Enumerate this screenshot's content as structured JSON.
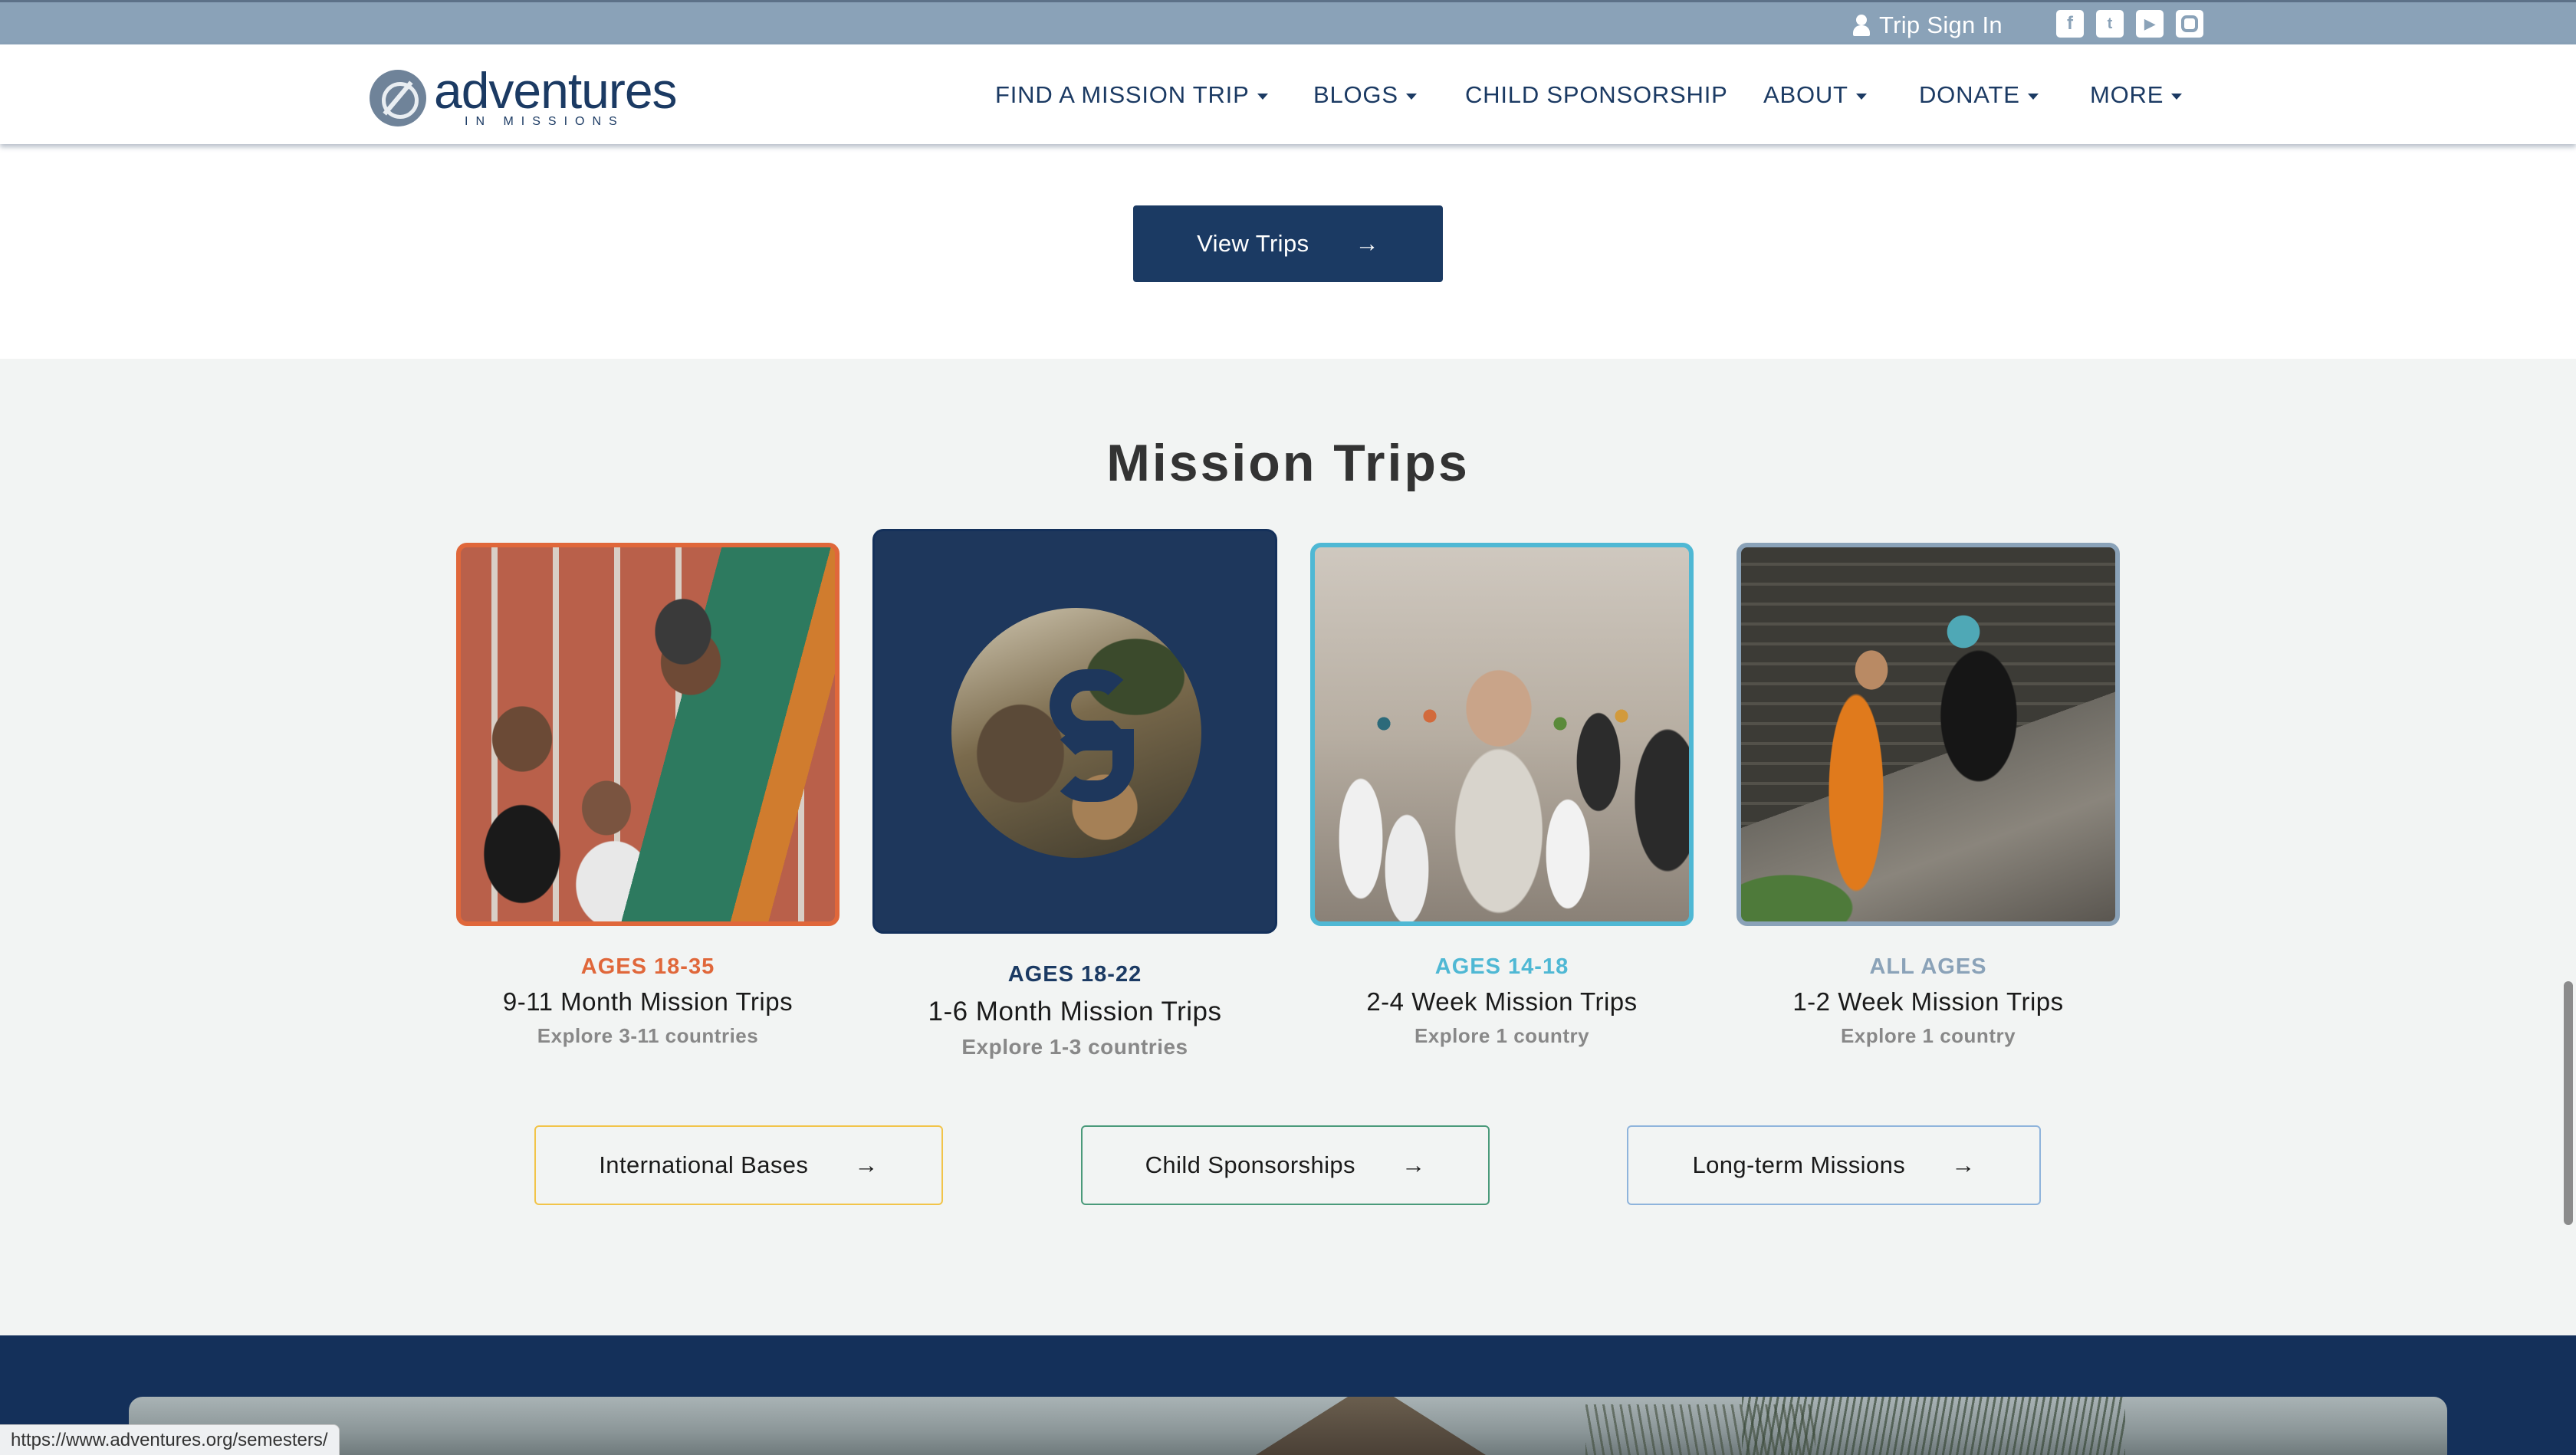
{
  "topbar": {
    "signin_label": "Trip Sign In",
    "social_icons": [
      "facebook-icon",
      "twitter-icon",
      "youtube-icon",
      "instagram-icon"
    ]
  },
  "logo": {
    "name": "adventures",
    "sub": "IN MISSIONS"
  },
  "nav": {
    "items": [
      {
        "label": "FIND A MISSION TRIP",
        "dropdown": true
      },
      {
        "label": "BLOGS",
        "dropdown": true
      },
      {
        "label": "CHILD SPONSORSHIP",
        "dropdown": false
      },
      {
        "label": "ABOUT",
        "dropdown": true
      },
      {
        "label": "DONATE",
        "dropdown": true
      },
      {
        "label": "MORE",
        "dropdown": true
      }
    ]
  },
  "view_trips": {
    "label": "View Trips",
    "arrow": "→"
  },
  "section": {
    "title": "Mission Trips"
  },
  "cards": [
    {
      "age": "AGES 18-35",
      "title": "9-11 Month Mission Trips",
      "sub": "Explore 3-11 countries",
      "accent": "#e0673a"
    },
    {
      "age": "AGES 18-22",
      "title": "1-6 Month Mission Trips",
      "sub": "Explore 1-3 countries",
      "accent": "#1b3a63"
    },
    {
      "age": "AGES 14-18",
      "title": "2-4 Week Mission Trips",
      "sub": "Explore 1 country",
      "accent": "#4fb8d4"
    },
    {
      "age": "ALL AGES",
      "title": "1-2 Week Mission Trips",
      "sub": "Explore 1 country",
      "accent": "#8aa2b8"
    }
  ],
  "buttons": [
    {
      "label": "International Bases",
      "arrow": "→",
      "border": "#f2c449"
    },
    {
      "label": "Child Sponsorships",
      "arrow": "→",
      "border": "#4a9a7a"
    },
    {
      "label": "Long-term Missions",
      "arrow": "→",
      "border": "#8fb4dc"
    }
  ],
  "status_url": "https://www.adventures.org/semesters/"
}
